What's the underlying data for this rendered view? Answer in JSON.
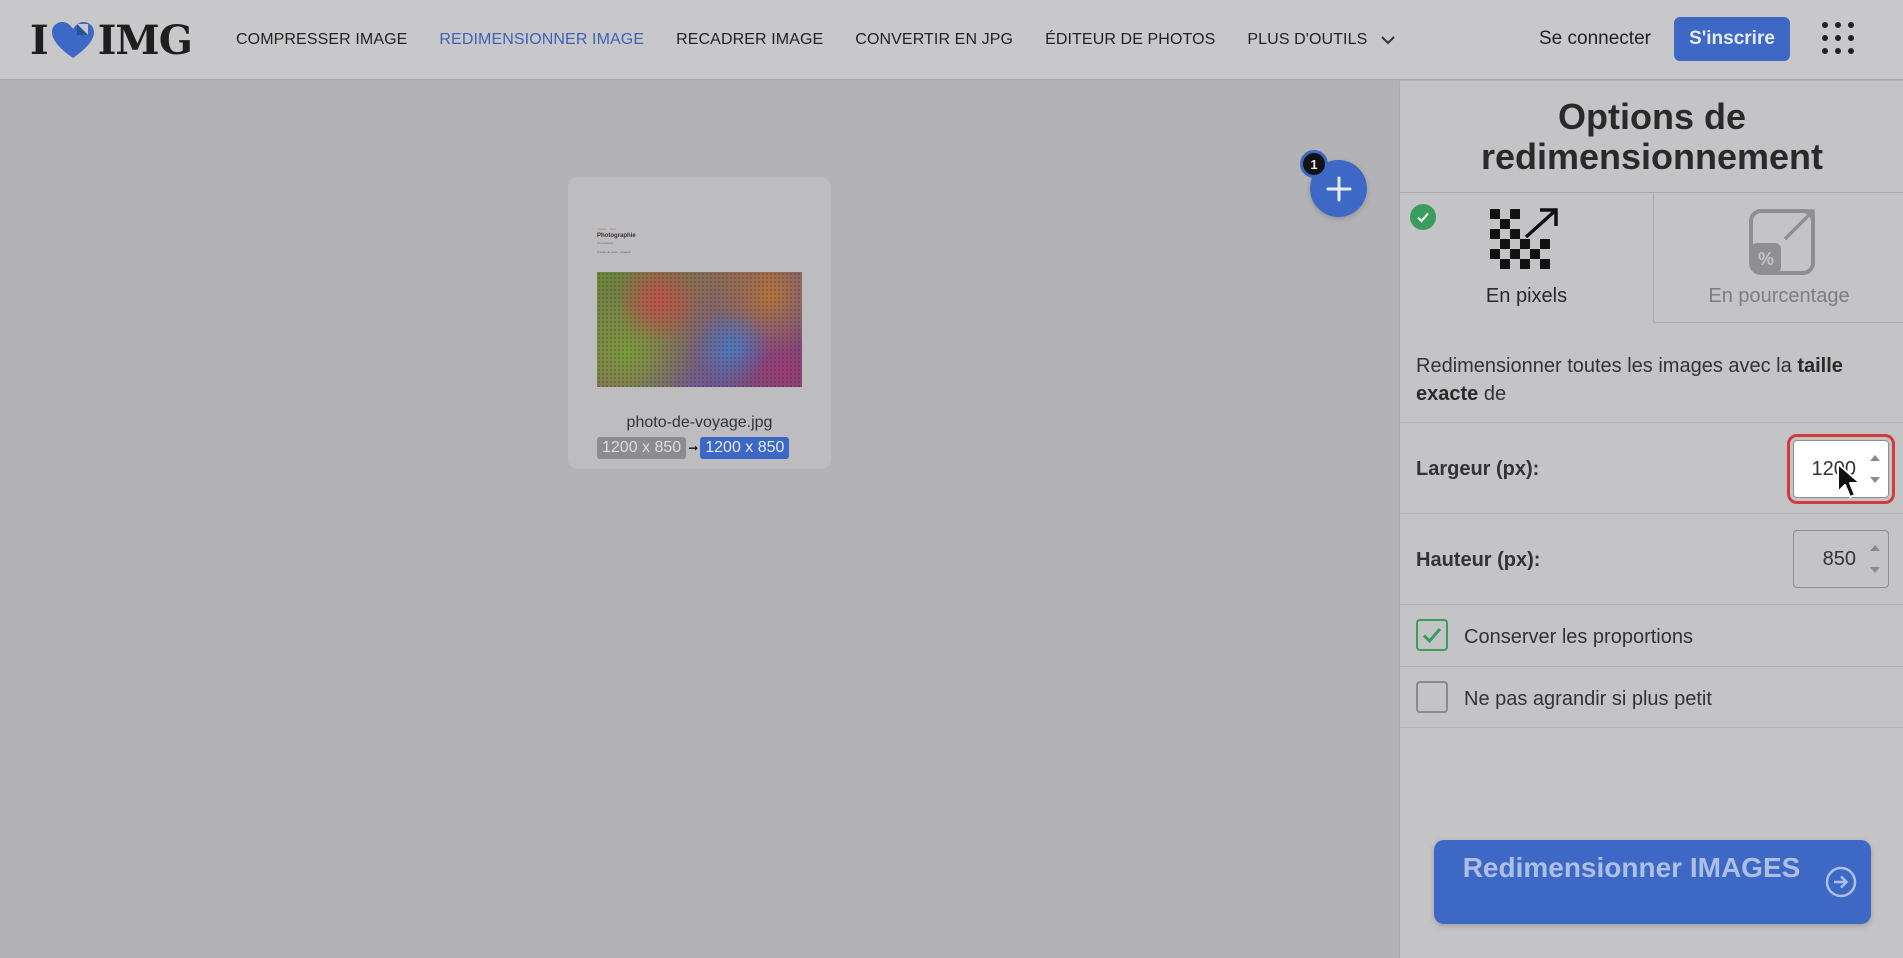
{
  "header": {
    "logo_left": "I",
    "logo_right": "IMG",
    "nav": [
      {
        "label": "COMPRESSER IMAGE"
      },
      {
        "label": "REDIMENSIONNER IMAGE"
      },
      {
        "label": "RECADRER IMAGE"
      },
      {
        "label": "CONVERTIR EN JPG"
      },
      {
        "label": "ÉDITEUR DE PHOTOS"
      },
      {
        "label": "PLUS D'OUTILS"
      }
    ],
    "active_nav": "REDIMENSIONNER IMAGE",
    "login_label": "Se connecter",
    "signup_label": "S'inscrire"
  },
  "workspace": {
    "add_count": "1",
    "file": {
      "name": "photo-de-voyage.jpg",
      "original_size": "1200 x 850",
      "arrow": "➞",
      "new_size": "1200 x 850",
      "preview": {
        "eyebrow": "Voyage · 2024",
        "title": "Photographie",
        "subtitle": "Un souvenir",
        "caption": "Carnet de route · Images"
      }
    }
  },
  "panel": {
    "title": "Options de redimensionnement",
    "tabs": [
      {
        "label": "En pixels",
        "selected": true,
        "icon": "pixels-resize-icon"
      },
      {
        "label": "En pourcentage",
        "selected": false,
        "icon": "percentage-resize-icon"
      }
    ],
    "description_start": "Redimensionner toutes les images avec la ",
    "description_bold": "taille exacte",
    "description_end": " de",
    "width_label": "Largeur (px):",
    "width_value": "1200",
    "height_label": "Hauteur (px):",
    "height_value": "850",
    "keep_ratio_label": "Conserver les proportions",
    "keep_ratio_checked": true,
    "no_enlarge_label": "Ne pas agrandir si plus petit",
    "no_enlarge_checked": false,
    "submit_label": "Redimensionner IMAGES"
  },
  "colors": {
    "accent": "#3d68c5",
    "active_nav": "#3d62b4",
    "success": "#3b9c5f",
    "focus_ring": "#d33a3a"
  }
}
